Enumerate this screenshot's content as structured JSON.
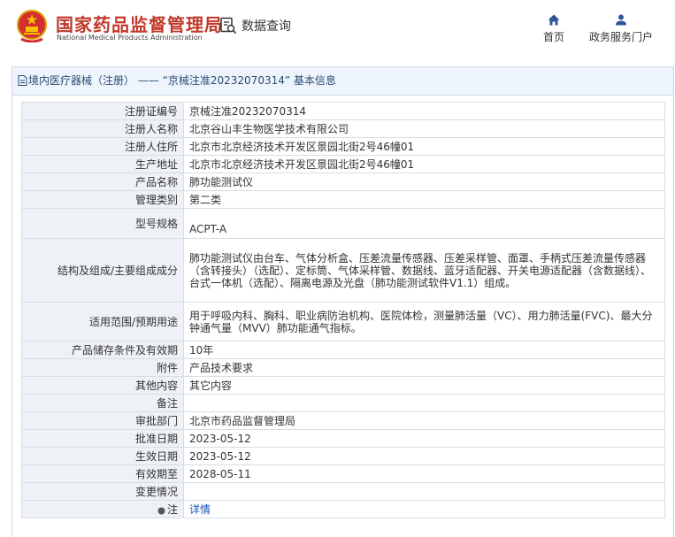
{
  "header": {
    "agency_name_cn": "国家药品监督管理局",
    "agency_name_en": "National Medical Products Administration",
    "search_label": "数据查询",
    "nav": {
      "home": "首页",
      "services": "政务服务门户"
    }
  },
  "breadcrumb": {
    "category": "境内医疗器械（注册）",
    "separator": " —— ",
    "current": "“京械注准20232070314” 基本信息"
  },
  "details": {
    "rows": [
      {
        "label": "注册证编号",
        "value": "京械注准20232070314"
      },
      {
        "label": "注册人名称",
        "value": "北京谷山丰生物医学技术有限公司"
      },
      {
        "label": "注册人住所",
        "value": "北京市北京经济技术开发区景园北街2号46幢01"
      },
      {
        "label": "生产地址",
        "value": "北京市北京经济技术开发区景园北街2号46幢01"
      },
      {
        "label": "产品名称",
        "value": "肺功能测试仪"
      },
      {
        "label": "管理类别",
        "value": "第二类"
      },
      {
        "label": "型号规格",
        "value": "ACPT-A"
      },
      {
        "label": "结构及组成/主要组成成分",
        "value": "肺功能测试仪由台车、气体分析盒、压差流量传感器、压差采样管、面罩、手柄式压差流量传感器（含转接头）（选配）、定标筒、气体采样管、数据线、蓝牙适配器、开关电源适配器（含数据线）、台式一体机（选配）、隔离电源及光盘（肺功能测试软件V1.1）组成。"
      },
      {
        "label": "适用范围/预期用途",
        "value": "用于呼吸内科、胸科、职业病防治机构、医院体检，测量肺活量（VC）、用力肺活量(FVC)、最大分钟通气量（MVV）肺功能通气指标。"
      },
      {
        "label": "产品储存条件及有效期",
        "value": "10年"
      },
      {
        "label": "附件",
        "value": "产品技术要求"
      },
      {
        "label": "其他内容",
        "value": "其它内容"
      },
      {
        "label": "备注",
        "value": ""
      },
      {
        "label": "审批部门",
        "value": "北京市药品监督管理局"
      },
      {
        "label": "批准日期",
        "value": "2023-05-12"
      },
      {
        "label": "生效日期",
        "value": "2023-05-12"
      },
      {
        "label": "有效期至",
        "value": "2028-05-11"
      },
      {
        "label": "变更情况",
        "value": ""
      },
      {
        "label": "注",
        "value": "详情"
      }
    ]
  },
  "colors": {
    "brand_red": "#c0392b",
    "link_blue": "#1a56b8",
    "title_blue": "#2b4a78",
    "nav_icon": "#2f5597"
  },
  "icons": [
    "national-emblem-icon",
    "data-search-icon",
    "home-icon",
    "user-icon",
    "document-icon",
    "note-icon"
  ]
}
